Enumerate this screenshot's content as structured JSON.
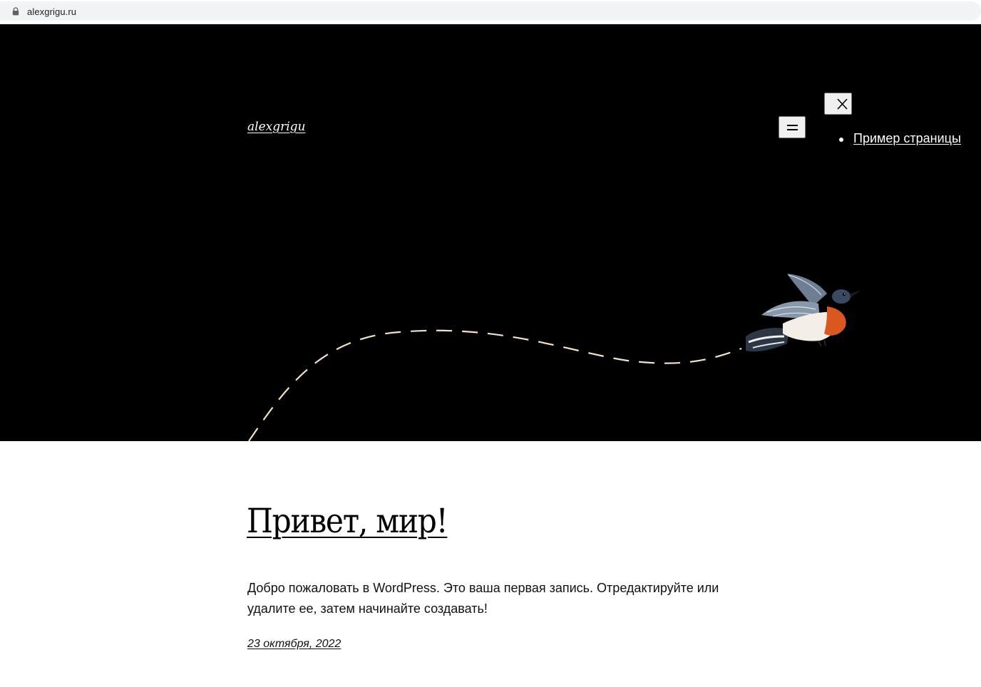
{
  "browser": {
    "url": "alexgrigu.ru",
    "lock_icon": "lock-icon"
  },
  "header": {
    "site_title": "alexgrigu",
    "menu_icon": "hamburger-icon",
    "close_icon": "close-icon",
    "nav_items": [
      {
        "label": "Пример страницы"
      }
    ]
  },
  "hero": {
    "illustration": "bird-with-dashed-flight-path",
    "background": "#000000",
    "path_color": "#f3e2c8"
  },
  "post": {
    "title": "Привет, мир!",
    "excerpt": "Добро пожаловать в WordPress. Это ваша первая запись. Отредактируйте или удалите ее, затем начинайте создавать!",
    "date": "23 октября, 2022"
  }
}
